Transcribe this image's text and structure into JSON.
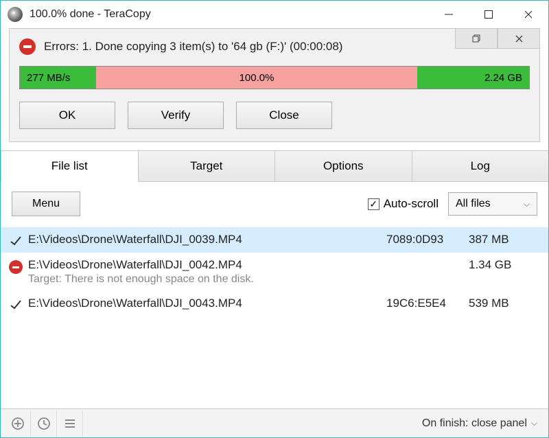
{
  "window": {
    "title": "100.0% done - TeraCopy"
  },
  "status": {
    "text": "Errors: 1. Done copying 3 item(s) to '64 gb (F:)' (00:00:08)",
    "speed": "277 MB/s",
    "percent": "100.0%",
    "total": "2.24 GB",
    "buttons": {
      "ok": "OK",
      "verify": "Verify",
      "close": "Close"
    }
  },
  "tabs": {
    "file_list": "File list",
    "target": "Target",
    "options": "Options",
    "log": "Log"
  },
  "toolbar": {
    "menu": "Menu",
    "autoscroll": "Auto-scroll",
    "filter": "All files"
  },
  "files": [
    {
      "path": "E:\\Videos\\Drone\\Waterfall\\DJI_0039.MP4",
      "hash": "7089:0D93",
      "size": "387 MB"
    },
    {
      "path": "E:\\Videos\\Drone\\Waterfall\\DJI_0042.MP4",
      "hash": "",
      "size": "1.34 GB",
      "error": "Target: There is not enough space on the disk."
    },
    {
      "path": "E:\\Videos\\Drone\\Waterfall\\DJI_0043.MP4",
      "hash": "19C6:E5E4",
      "size": "539 MB"
    }
  ],
  "statusbar": {
    "on_finish": "On finish: close panel"
  }
}
